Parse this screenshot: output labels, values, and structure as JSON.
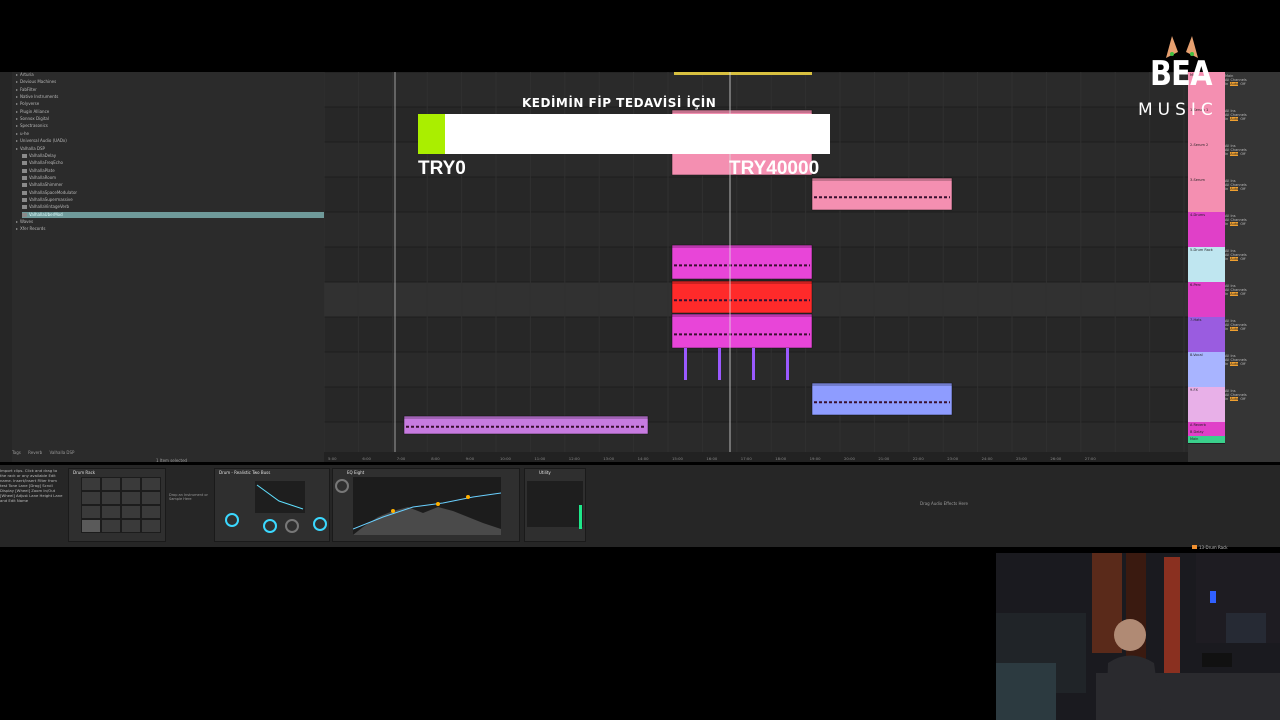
{
  "overlay": {
    "donation_title": "KEDİMİN FİP TEDAVİSİ İÇİN",
    "goal_start": "TRY0",
    "goal_end": "TRY40000",
    "progress_fraction": 0.065,
    "accent_color": "#aaee00"
  },
  "logo": {
    "brand": "BEA",
    "sub": "MUSIC"
  },
  "browser": {
    "items": [
      {
        "label": "Arturia",
        "level": 0
      },
      {
        "label": "Devious Machines",
        "level": 0
      },
      {
        "label": "FabFilter",
        "level": 0
      },
      {
        "label": "Native Instruments",
        "level": 0
      },
      {
        "label": "Polyverse",
        "level": 0
      },
      {
        "label": "Plugin Alliance",
        "level": 0
      },
      {
        "label": "Sonnox Digital",
        "level": 0
      },
      {
        "label": "Spectrasonics",
        "level": 0
      },
      {
        "label": "u-he",
        "level": 0
      },
      {
        "label": "Universal Audio (UADx)",
        "level": 0
      },
      {
        "label": "Valhalla DSP",
        "level": 0
      },
      {
        "label": "ValhallaDelay",
        "level": 1
      },
      {
        "label": "ValhallaFreqEcho",
        "level": 1
      },
      {
        "label": "ValhallaPlate",
        "level": 1
      },
      {
        "label": "ValhallaRoom",
        "level": 1
      },
      {
        "label": "ValhallaShimmer",
        "level": 1
      },
      {
        "label": "ValhallaSpaceModulator",
        "level": 1
      },
      {
        "label": "ValhallaSupermassive",
        "level": 1
      },
      {
        "label": "ValhallaVintageVerb",
        "level": 1
      },
      {
        "label": "ValhallaUberMod",
        "level": 1,
        "selected": true
      },
      {
        "label": "Waves",
        "level": 0
      },
      {
        "label": "Xfer Records",
        "level": 0
      }
    ],
    "footer_tabs": [
      "Tags",
      "Reverb",
      "Valhalla DSP"
    ],
    "status": "1 Item selected"
  },
  "info_view": {
    "text": "Import clips. Click and drag to the rack or any available Edit name. Insert/Insert Filter from test Tone Lane [Drag] Scroll Display [Wheel] Zoom In/Out [Wheel] Adjust Lane Height Lane and Edit Name"
  },
  "devices": [
    {
      "title": "Drum Rack"
    },
    {
      "title": "Drum Buss"
    },
    {
      "title": "Drum - Realistic Two Buss"
    },
    {
      "title": "EQ Eight"
    },
    {
      "title": "Utility"
    }
  ],
  "device_hint": "Drag Audio Effects Here",
  "drop_hint": "Drop an Instrument or Sample Here",
  "tracks": [
    {
      "name": "Main",
      "color": "#f48fb1"
    },
    {
      "name": "1-Serum 1",
      "color": "#f48fb1"
    },
    {
      "name": "2-Serum 2",
      "color": "#f48fb1"
    },
    {
      "name": "3-Serum",
      "color": "#f48fb1"
    },
    {
      "name": "4-Drums",
      "color": "#e040c8"
    },
    {
      "name": "5-Drum Rack",
      "color": "#bfe6f0"
    },
    {
      "name": "6-Perc",
      "color": "#e040c8"
    },
    {
      "name": "7-Hats",
      "color": "#9a5ce0"
    },
    {
      "name": "8-Vocal",
      "color": "#a8b4ff"
    },
    {
      "name": "9-FX",
      "color": "#e8b0e8"
    }
  ],
  "returns": [
    {
      "name": "A Reverb",
      "color": "#e040c8"
    },
    {
      "name": "B Delay",
      "color": "#e040c8"
    },
    {
      "name": "Main",
      "color": "#3ad08c"
    }
  ],
  "io": {
    "route_in": "All Ins",
    "channel": "All Channels",
    "monitor": [
      "In",
      "Auto",
      "Off"
    ],
    "main": "Main"
  },
  "statusbar": {
    "right": "13-Drum Rack"
  },
  "time_ruler": [
    "5:00",
    "6:00",
    "7:00",
    "8:00",
    "9:00",
    "10:00",
    "11:00",
    "12:00",
    "13:00",
    "14:00",
    "15:00",
    "16:00",
    "17:00",
    "18:00",
    "19:00",
    "20:00",
    "21:00",
    "22:00",
    "23:00",
    "24:00",
    "25:00",
    "26:00",
    "27:00"
  ],
  "colors": {
    "pink": "#f48fb1",
    "magenta": "#e845d8",
    "red": "#ff2a2a",
    "violet": "#9b59ff",
    "periwinkle": "#8e9cff",
    "orchid": "#c77be0"
  }
}
